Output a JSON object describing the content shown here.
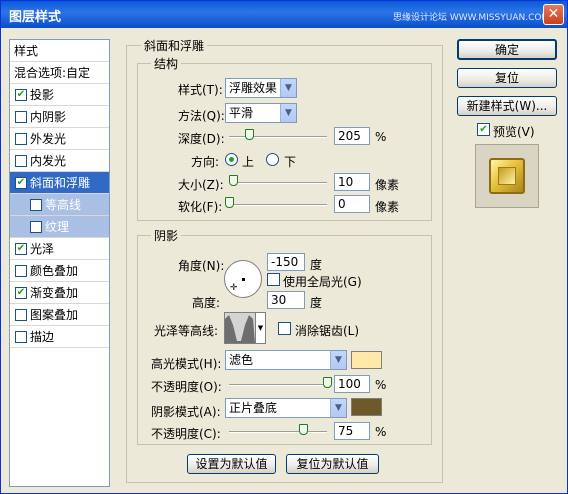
{
  "window": {
    "title": "图层样式",
    "watermark": "思缘设计论坛 WWW.MISSYUAN.COM",
    "close_glyph": "✕"
  },
  "style_list": [
    {
      "label": "样式",
      "checkbox": false,
      "checked": false,
      "selected": false,
      "sub": false
    },
    {
      "label": "混合选项:自定",
      "checkbox": false,
      "checked": false,
      "selected": false,
      "sub": false
    },
    {
      "label": "投影",
      "checkbox": true,
      "checked": true,
      "selected": false,
      "sub": false
    },
    {
      "label": "内阴影",
      "checkbox": true,
      "checked": false,
      "selected": false,
      "sub": false
    },
    {
      "label": "外发光",
      "checkbox": true,
      "checked": false,
      "selected": false,
      "sub": false
    },
    {
      "label": "内发光",
      "checkbox": true,
      "checked": false,
      "selected": false,
      "sub": false
    },
    {
      "label": "斜面和浮雕",
      "checkbox": true,
      "checked": true,
      "selected": true,
      "sub": false
    },
    {
      "label": "等高线",
      "checkbox": true,
      "checked": false,
      "selected": false,
      "sub": true
    },
    {
      "label": "纹理",
      "checkbox": true,
      "checked": false,
      "selected": false,
      "sub": true
    },
    {
      "label": "光泽",
      "checkbox": true,
      "checked": true,
      "selected": false,
      "sub": false
    },
    {
      "label": "颜色叠加",
      "checkbox": true,
      "checked": false,
      "selected": false,
      "sub": false
    },
    {
      "label": "渐变叠加",
      "checkbox": true,
      "checked": true,
      "selected": false,
      "sub": false
    },
    {
      "label": "图案叠加",
      "checkbox": true,
      "checked": false,
      "selected": false,
      "sub": false
    },
    {
      "label": "描边",
      "checkbox": true,
      "checked": false,
      "selected": false,
      "sub": false
    }
  ],
  "bevel": {
    "group_title": "斜面和浮雕",
    "structure_title": "结构",
    "style_label": "样式(T):",
    "style_value": "浮雕效果",
    "technique_label": "方法(Q):",
    "technique_value": "平滑",
    "depth_label": "深度(D):",
    "depth_value": "205",
    "depth_unit": "%",
    "depth_fraction": 0.2,
    "direction_label": "方向:",
    "direction_up": "上",
    "direction_down": "下",
    "direction_selected": "up",
    "size_label": "大小(Z):",
    "size_value": "10",
    "size_unit": "像素",
    "size_fraction": 0.04,
    "soften_label": "软化(F):",
    "soften_value": "0",
    "soften_unit": "像素",
    "soften_fraction": 0.0
  },
  "shading": {
    "title": "阴影",
    "angle_label": "角度(N):",
    "angle_value": "-150",
    "angle_unit": "度",
    "global_light_label": "使用全局光(G)",
    "global_light_checked": false,
    "altitude_label": "高度:",
    "altitude_value": "30",
    "altitude_unit": "度",
    "gloss_label": "光泽等高线:",
    "antialias_label": "消除锯齿(L)",
    "antialias_checked": false,
    "highlight_mode_label": "高光模式(H):",
    "highlight_mode_value": "滤色",
    "highlight_color": "#ffe8a8",
    "highlight_opacity_label": "不透明度(O):",
    "highlight_opacity_value": "100",
    "highlight_opacity_fraction": 1.0,
    "shadow_mode_label": "阴影模式(A):",
    "shadow_mode_value": "正片叠底",
    "shadow_color": "#6e5a28",
    "shadow_opacity_label": "不透明度(C):",
    "shadow_opacity_value": "75",
    "shadow_opacity_fraction": 0.75,
    "percent": "%"
  },
  "bottom_buttons": {
    "make_default": "设置为默认值",
    "reset_default": "复位为默认值"
  },
  "right": {
    "ok": "确定",
    "reset": "复位",
    "new_style": "新建样式(W)...",
    "preview_label": "预览(V)",
    "preview_checked": true
  },
  "icons": {
    "dropdown": "▼",
    "check": "✔"
  }
}
